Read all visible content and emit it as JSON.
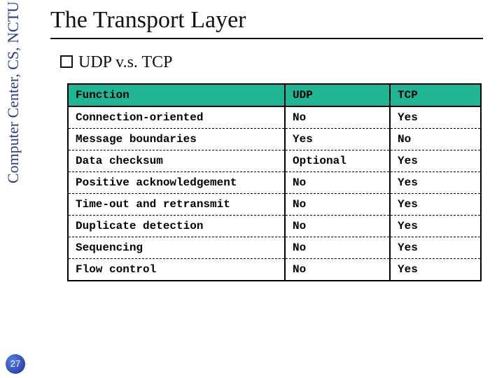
{
  "sidebar": {
    "org_text": "Computer Center, CS, NCTU"
  },
  "page_number": "27",
  "title": "The Transport Layer",
  "subheading": "UDP v.s. TCP",
  "table": {
    "headers": {
      "c1": "Function",
      "c2": "UDP",
      "c3": "TCP"
    },
    "rows": [
      {
        "fn": "Connection-oriented",
        "udp": "No",
        "tcp": "Yes"
      },
      {
        "fn": "Message boundaries",
        "udp": "Yes",
        "tcp": "No"
      },
      {
        "fn": "Data checksum",
        "udp": "Optional",
        "tcp": "Yes"
      },
      {
        "fn": "Positive acknowledgement",
        "udp": "No",
        "tcp": "Yes"
      },
      {
        "fn": "Time-out and retransmit",
        "udp": "No",
        "tcp": "Yes"
      },
      {
        "fn": "Duplicate detection",
        "udp": "No",
        "tcp": "Yes"
      },
      {
        "fn": "Sequencing",
        "udp": "No",
        "tcp": "Yes"
      },
      {
        "fn": "Flow control",
        "udp": "No",
        "tcp": "Yes"
      }
    ]
  }
}
